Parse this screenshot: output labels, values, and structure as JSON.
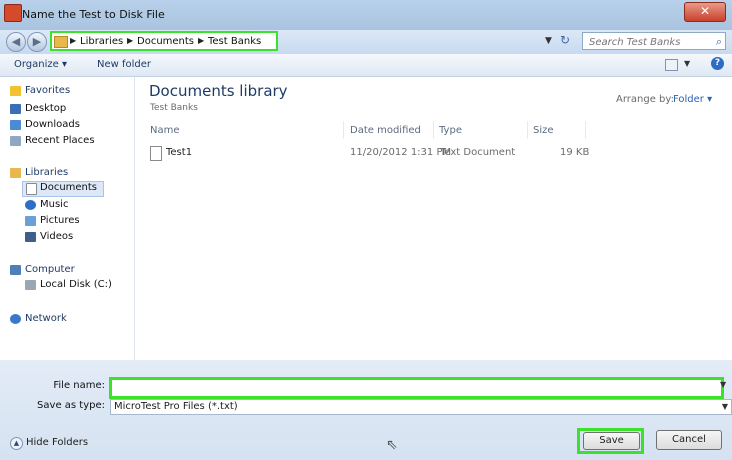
{
  "window": {
    "title": "Name the Test to Disk File"
  },
  "address_bar": {
    "breadcrumbs": [
      "Libraries",
      "Documents",
      "Test Banks"
    ],
    "search_placeholder": "Search Test Banks"
  },
  "toolbar": {
    "organize": "Organize",
    "new_folder": "New folder"
  },
  "nav_pane": {
    "favorites": {
      "label": "Favorites",
      "items": [
        "Desktop",
        "Downloads",
        "Recent Places"
      ]
    },
    "libraries": {
      "label": "Libraries",
      "items": [
        "Documents",
        "Music",
        "Pictures",
        "Videos"
      ],
      "selected": "Documents"
    },
    "computer": {
      "label": "Computer",
      "items": [
        "Local Disk (C:)"
      ]
    },
    "network": {
      "label": "Network"
    }
  },
  "content": {
    "library_title": "Documents library",
    "library_subtitle": "Test Banks",
    "arrange_by_label": "Arrange by:",
    "arrange_by_value": "Folder",
    "columns": [
      "Name",
      "Date modified",
      "Type",
      "Size"
    ],
    "files": [
      {
        "name": "Test1",
        "date_modified": "11/20/2012 1:31 PM",
        "type": "Text Document",
        "size": "19 KB"
      }
    ]
  },
  "bottom": {
    "file_name_label": "File name:",
    "file_name_value": "",
    "save_as_type_label": "Save as type:",
    "save_as_type_value": "MicroTest Pro Files (*.txt)",
    "hide_folders": "Hide Folders",
    "save": "Save",
    "cancel": "Cancel"
  },
  "colors": {
    "highlight": "#3be12a",
    "link_blue": "#2b64b5",
    "title_blue": "#1e3b66"
  }
}
